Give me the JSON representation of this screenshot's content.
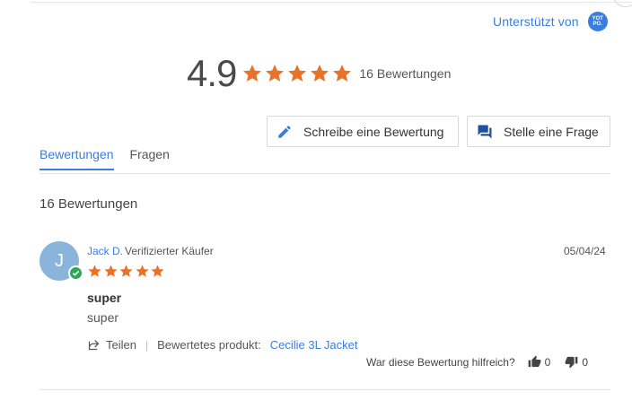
{
  "powered_by": {
    "label": "Unterstützt von",
    "logo_text": "YOT\nPO."
  },
  "summary": {
    "average": "4.9",
    "star_count": 5,
    "total_label": "16 Bewertungen"
  },
  "buttons": {
    "write_review": "Schreibe eine Bewertung",
    "ask_question": "Stelle eine Frage"
  },
  "tabs": [
    {
      "label": "Bewertungen",
      "active": true
    },
    {
      "label": "Fragen",
      "active": false
    }
  ],
  "reviews_heading": "16 Bewertungen",
  "review": {
    "avatar_initial": "J",
    "name": "Jack D.",
    "status": "Verifizierter Käufer",
    "date": "05/04/24",
    "rating": 5,
    "title": "super",
    "body": "super",
    "share_label": "Teilen",
    "product_label": "Bewertetes produkt:",
    "product_name": "Cecilie 3L Jacket",
    "helpful_question": "War diese Bewertung hilfreich?",
    "upvotes": "0",
    "downvotes": "0"
  },
  "colors": {
    "accent": "#3b7ddd",
    "star": "#e8722a",
    "verified": "#2fa45a",
    "avatar": "#8ab4da"
  }
}
